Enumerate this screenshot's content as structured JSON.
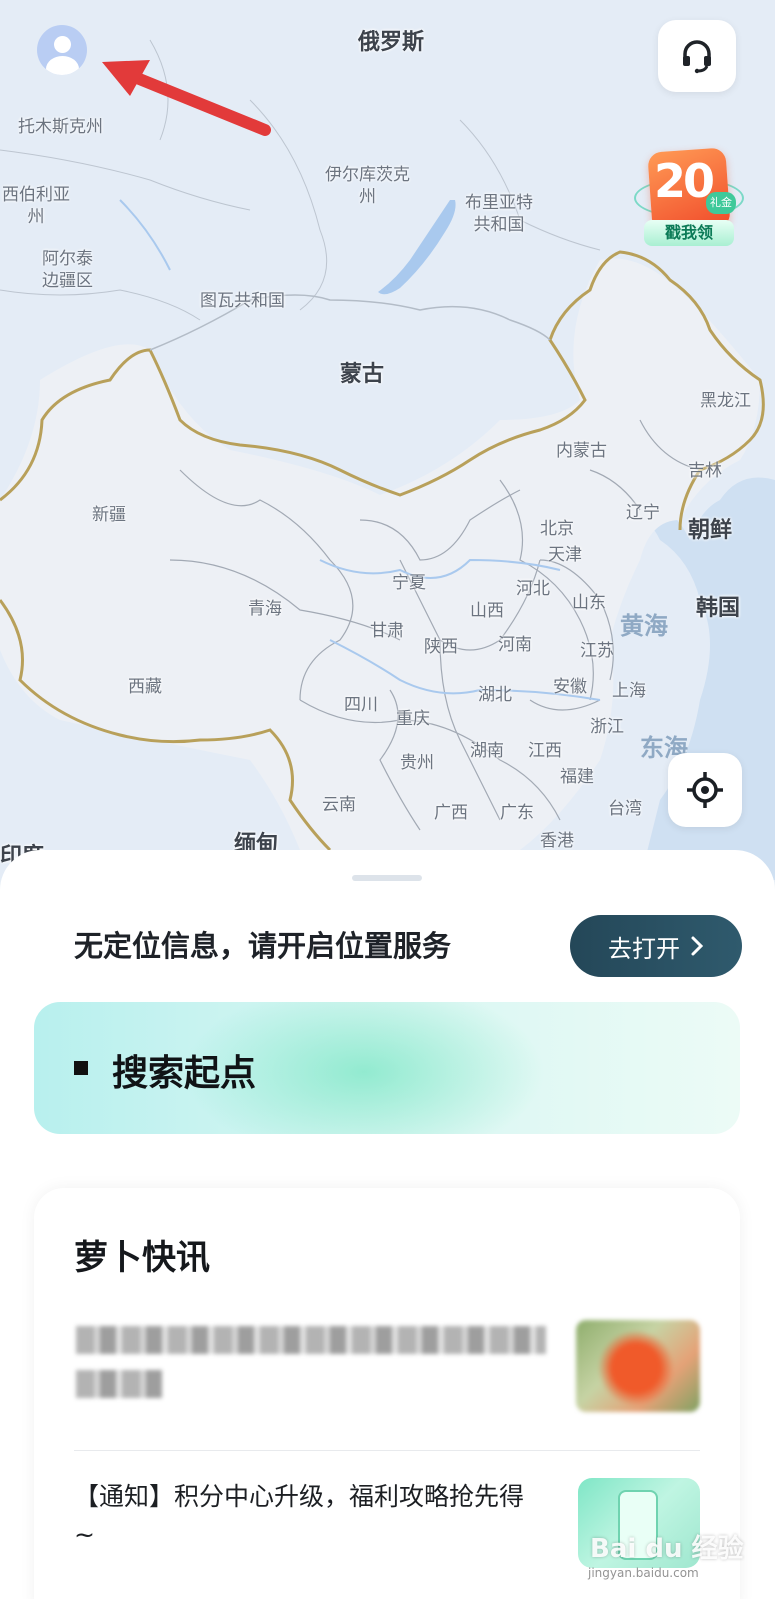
{
  "map": {
    "labels": [
      {
        "id": "russia",
        "text": "俄罗斯",
        "kind": "country"
      },
      {
        "id": "tomsk",
        "text": "托木斯克州",
        "kind": "region"
      },
      {
        "id": "irkutsk",
        "text": "伊尔库茨克\n州",
        "kind": "region"
      },
      {
        "id": "buryatia",
        "text": "布里亚特\n共和国",
        "kind": "region"
      },
      {
        "id": "w-siberia",
        "text": "西伯利亚\n州",
        "kind": "region"
      },
      {
        "id": "altai",
        "text": "阿尔泰\n边疆区",
        "kind": "region"
      },
      {
        "id": "tuva",
        "text": "图瓦共和国",
        "kind": "region"
      },
      {
        "id": "mongolia",
        "text": "蒙古",
        "kind": "country"
      },
      {
        "id": "heilongjiang",
        "text": "黑龙江",
        "kind": "province"
      },
      {
        "id": "neimenggu",
        "text": "内蒙古",
        "kind": "province"
      },
      {
        "id": "jilin",
        "text": "吉林",
        "kind": "province"
      },
      {
        "id": "xinjiang",
        "text": "新疆",
        "kind": "province"
      },
      {
        "id": "liaoning",
        "text": "辽宁",
        "kind": "province"
      },
      {
        "id": "nkorea",
        "text": "朝鲜",
        "kind": "country"
      },
      {
        "id": "beijing",
        "text": "北京",
        "kind": "province"
      },
      {
        "id": "tianjin",
        "text": "天津",
        "kind": "province"
      },
      {
        "id": "ningxia",
        "text": "宁夏",
        "kind": "province"
      },
      {
        "id": "hebei",
        "text": "河北",
        "kind": "province"
      },
      {
        "id": "shandong",
        "text": "山东",
        "kind": "province"
      },
      {
        "id": "skorea",
        "text": "韩国",
        "kind": "country"
      },
      {
        "id": "qinghai",
        "text": "青海",
        "kind": "province"
      },
      {
        "id": "shanxi",
        "text": "山西",
        "kind": "province"
      },
      {
        "id": "yellowsea",
        "text": "黄海",
        "kind": "sea"
      },
      {
        "id": "gansu",
        "text": "甘肃",
        "kind": "province"
      },
      {
        "id": "shaanxi",
        "text": "陕西",
        "kind": "province"
      },
      {
        "id": "henan",
        "text": "河南",
        "kind": "province"
      },
      {
        "id": "jiangsu",
        "text": "江苏",
        "kind": "province"
      },
      {
        "id": "anhui",
        "text": "安徽",
        "kind": "province"
      },
      {
        "id": "shanghai",
        "text": "上海",
        "kind": "province"
      },
      {
        "id": "xizang",
        "text": "西藏",
        "kind": "province"
      },
      {
        "id": "sichuan",
        "text": "四川",
        "kind": "province"
      },
      {
        "id": "hubei",
        "text": "湖北",
        "kind": "province"
      },
      {
        "id": "chongqing",
        "text": "重庆",
        "kind": "province"
      },
      {
        "id": "zhejiang",
        "text": "浙江",
        "kind": "province"
      },
      {
        "id": "guizhou",
        "text": "贵州",
        "kind": "province"
      },
      {
        "id": "hunan",
        "text": "湖南",
        "kind": "province"
      },
      {
        "id": "jiangxi",
        "text": "江西",
        "kind": "province"
      },
      {
        "id": "eastsea",
        "text": "东海",
        "kind": "sea"
      },
      {
        "id": "fujian",
        "text": "福建",
        "kind": "province"
      },
      {
        "id": "yunnan",
        "text": "云南",
        "kind": "province"
      },
      {
        "id": "guangxi",
        "text": "广西",
        "kind": "province"
      },
      {
        "id": "guangdong",
        "text": "广东",
        "kind": "province"
      },
      {
        "id": "taiwan",
        "text": "台湾",
        "kind": "province"
      },
      {
        "id": "hongkong",
        "text": "香港",
        "kind": "province"
      },
      {
        "id": "myanmar",
        "text": "缅甸",
        "kind": "country"
      },
      {
        "id": "india",
        "text": "印度",
        "kind": "country"
      }
    ]
  },
  "coupon": {
    "amount": "20",
    "tag": "礼金",
    "cta": "戳我领"
  },
  "sheet": {
    "location_message": "无定位信息，请开启位置服务",
    "open_button": "去打开",
    "search_placeholder": "搜索起点",
    "news": {
      "title": "萝卜快讯",
      "notice": "【通知】积分中心升级，福利攻略抢先得~"
    }
  },
  "watermark": {
    "brand": "Bai du 经验",
    "url": "jingyan.baidu.com"
  },
  "colors": {
    "map_bg": "#e4ecf6",
    "border_gold": "#b8a05a",
    "accent_dark": "#244758",
    "arrow_red": "#e23a3a"
  }
}
